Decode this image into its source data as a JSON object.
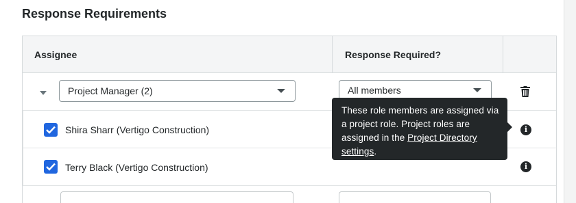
{
  "section": {
    "title": "Response Requirements"
  },
  "table": {
    "headers": {
      "assignee": "Assignee",
      "response_required": "Response Required?"
    },
    "group": {
      "assignee_value": "Project Manager (2)",
      "response_value": "All members"
    },
    "members": [
      {
        "label": "Shira Sharr (Vertigo Construction)",
        "checked": true
      },
      {
        "label": "Terry Black (Vertigo Construction)",
        "checked": true
      }
    ]
  },
  "tooltip": {
    "text_before": "These role members are assigned via a project role. Project roles are assigned in the ",
    "link_text": "Project Directory settings",
    "text_after": "."
  },
  "icons": {
    "trash": "trash-icon",
    "info": "info-icon",
    "caret": "caret-down-icon",
    "check": "check-icon"
  },
  "colors": {
    "checkbox": "#2066df",
    "tooltip_bg": "#232729",
    "header_bg": "#f4f5f6"
  }
}
